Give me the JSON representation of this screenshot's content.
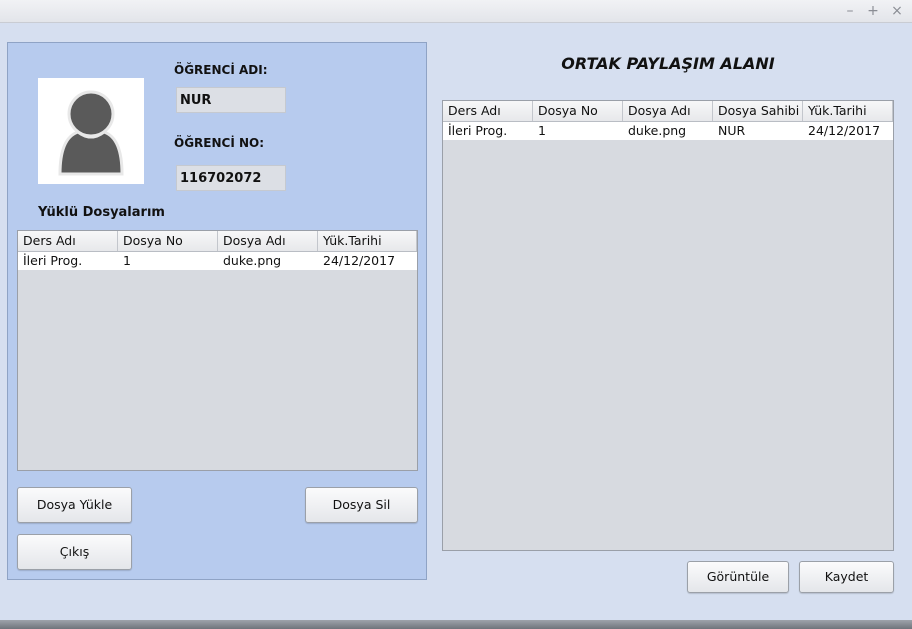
{
  "window": {
    "controls": {
      "minimize": "–",
      "maximize": "+",
      "close": "×"
    }
  },
  "student": {
    "name_label": "ÖĞRENCİ ADI:",
    "name_value": "NUR",
    "no_label": "ÖĞRENCİ NO:",
    "no_value": "116702072"
  },
  "my_files": {
    "title": "Yüklü Dosyalarım",
    "columns": [
      "Ders Adı",
      "Dosya No",
      "Dosya Adı",
      "Yük.Tarihi"
    ],
    "rows": [
      [
        "İleri Prog.",
        "1",
        "duke.png",
        "24/12/2017"
      ]
    ]
  },
  "left_buttons": {
    "upload": "Dosya Yükle",
    "delete": "Dosya Sil",
    "exit": "Çıkış"
  },
  "shared": {
    "title": "ORTAK PAYLAŞIM ALANI",
    "columns": [
      "Ders Adı",
      "Dosya No",
      "Dosya Adı",
      "Dosya Sahibi",
      "Yük.Tarihi"
    ],
    "rows": [
      [
        "İleri Prog.",
        "1",
        "duke.png",
        "NUR",
        "24/12/2017"
      ]
    ]
  },
  "right_buttons": {
    "view": "Görüntüle",
    "save": "Kaydet"
  }
}
